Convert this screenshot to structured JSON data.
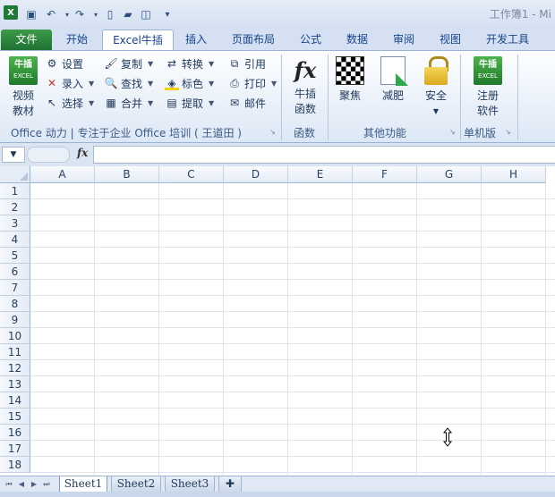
{
  "window": {
    "title": "工作簿1 - Mi"
  },
  "quick_access": [
    {
      "name": "save-icon",
      "glyph": "💾"
    },
    {
      "name": "undo-icon",
      "glyph": "↶"
    },
    {
      "name": "redo-icon",
      "glyph": "↷"
    },
    {
      "name": "new-icon",
      "glyph": "🗋"
    },
    {
      "name": "open-icon",
      "glyph": "📂"
    },
    {
      "name": "print-preview-icon",
      "glyph": "🔍"
    },
    {
      "name": "customize-icon",
      "glyph": "▾"
    }
  ],
  "tabs": {
    "file": "文件",
    "home": "开始",
    "excel_niucha": "Excel牛插",
    "insert": "插入",
    "page_layout": "页面布局",
    "formulas": "公式",
    "data": "数据",
    "review": "审阅",
    "view": "视图",
    "developer": "开发工具"
  },
  "ribbon": {
    "video_btn": {
      "logo_top": "牛插",
      "logo_bottom": "EXCEL",
      "line1": "视频",
      "line2": "教材"
    },
    "small_buttons": {
      "settings": "设置",
      "entry": "录入",
      "select": "选择",
      "copy": "复制",
      "find": "查找",
      "merge": "合并",
      "convert": "转换",
      "mark_color": "标色",
      "extract": "提取",
      "quote": "引用",
      "print": "打印",
      "mail": "邮件"
    },
    "group1_label": "Office 动力 | 专注于企业 Office 培训 ( 王道田 )",
    "functions_btn": {
      "line1": "牛插",
      "line2": "函数"
    },
    "functions_label": "函数",
    "focus_btn": "聚焦",
    "slim_btn": "减肥",
    "security_btn": "安全",
    "other_label": "其他功能",
    "register_btn": {
      "logo_top": "牛插",
      "logo_bottom": "EXCEL",
      "line1": "注册",
      "line2": "软件"
    },
    "standalone_label": "单机版"
  },
  "formula_bar": {
    "fx": "fx",
    "name_value": "",
    "formula_value": ""
  },
  "grid": {
    "columns": [
      "A",
      "B",
      "C",
      "D",
      "E",
      "F",
      "G",
      "H"
    ],
    "rows": [
      "1",
      "2",
      "3",
      "4",
      "5",
      "6",
      "7",
      "8",
      "9",
      "10",
      "11",
      "12",
      "13",
      "14",
      "15",
      "16",
      "17",
      "18"
    ]
  },
  "sheets": {
    "sheet1": "Sheet1",
    "sheet2": "Sheet2",
    "sheet3": "Sheet3"
  },
  "colors": {
    "file_tab": "#2a8a3c",
    "grid_line": "#dde4ee",
    "header_bg": "#e4ecf7"
  }
}
